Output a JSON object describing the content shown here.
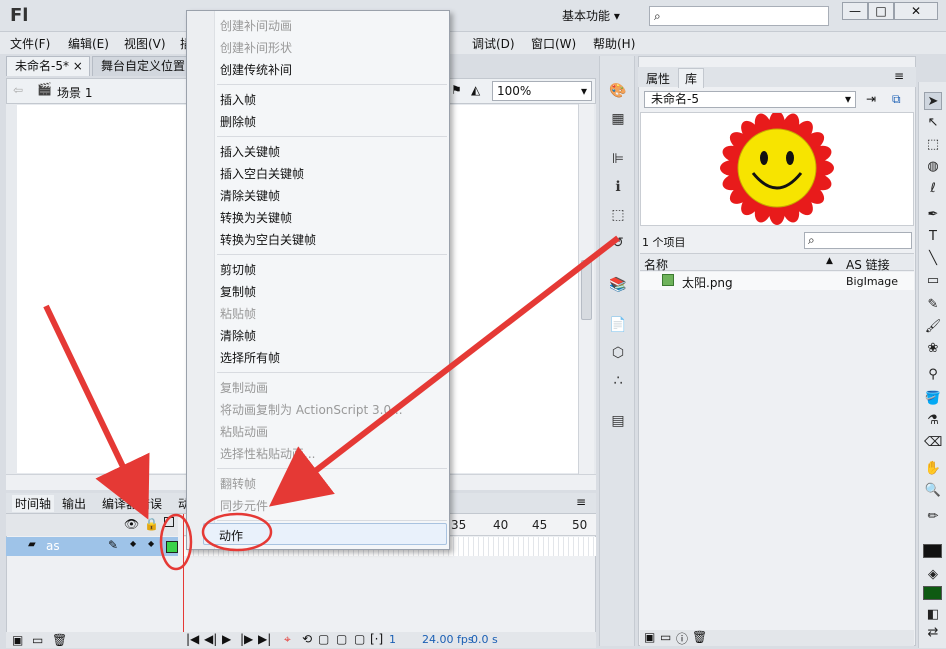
{
  "app": {
    "logo": "Fl",
    "workspace": "基本功能"
  },
  "window_buttons": [
    "—",
    "□",
    "✕"
  ],
  "menu": [
    "文件(F)",
    "编辑(E)",
    "视图(V)",
    "插",
    "调试(D)",
    "窗口(W)",
    "帮助(H)"
  ],
  "doc_tabs": [
    {
      "label": "未命名-5*",
      "close": "×"
    },
    {
      "label": "舞台自定义位置"
    }
  ],
  "scene": {
    "label": "场景 1",
    "zoom": "100%"
  },
  "timeline": {
    "tabs": [
      "时间轴",
      "输出",
      "编译器错误",
      "动"
    ],
    "layer": "as",
    "frame_numbers": [
      "35",
      "40",
      "45",
      "50"
    ],
    "fps": "24.00 fps",
    "time": "0.0 s",
    "frame": "1"
  },
  "context_menu": {
    "items": [
      {
        "label": "创建补间动画",
        "disabled": true
      },
      {
        "label": "创建补间形状",
        "disabled": true
      },
      {
        "label": "创建传统补间",
        "disabled": false
      },
      {
        "label": "插入帧",
        "disabled": false
      },
      {
        "label": "删除帧",
        "disabled": false
      },
      {
        "label": "插入关键帧",
        "disabled": false
      },
      {
        "label": "插入空白关键帧",
        "disabled": false
      },
      {
        "label": "清除关键帧",
        "disabled": false
      },
      {
        "label": "转换为关键帧",
        "disabled": false
      },
      {
        "label": "转换为空白关键帧",
        "disabled": false
      },
      {
        "label": "剪切帧",
        "disabled": false
      },
      {
        "label": "复制帧",
        "disabled": false
      },
      {
        "label": "粘贴帧",
        "disabled": true
      },
      {
        "label": "清除帧",
        "disabled": false
      },
      {
        "label": "选择所有帧",
        "disabled": false
      },
      {
        "label": "复制动画",
        "disabled": true
      },
      {
        "label": "将动画复制为 ActionScript 3.0...",
        "disabled": true
      },
      {
        "label": "粘贴动画",
        "disabled": true
      },
      {
        "label": "选择性粘贴动画...",
        "disabled": true
      },
      {
        "label": "翻转帧",
        "disabled": true
      },
      {
        "label": "同步元件",
        "disabled": true
      },
      {
        "label": "动作",
        "disabled": false
      }
    ]
  },
  "library": {
    "tabs": [
      "属性",
      "库"
    ],
    "doc": "未命名-5",
    "count": "1 个项目",
    "columns": [
      "名称",
      "AS 链接"
    ],
    "rows": [
      {
        "name": "太阳.png",
        "linkage": "BigImage"
      }
    ]
  },
  "colors": {
    "accent": "#e53935",
    "highlight": "#9ec3e8",
    "sun_petal": "#e81b1b",
    "sun_face": "#f7e400"
  }
}
